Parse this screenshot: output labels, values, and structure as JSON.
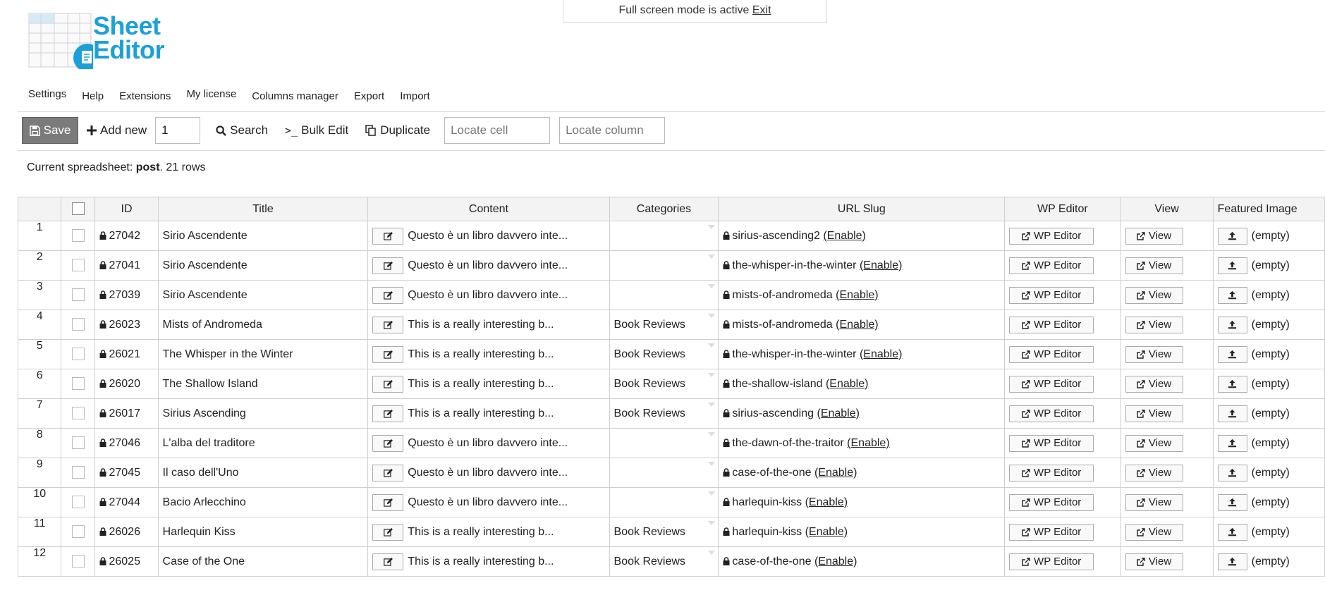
{
  "notice": {
    "text": "Full screen mode is active",
    "exit_label": "Exit"
  },
  "logo": {
    "line1": "Sheet",
    "line2": "Editor",
    "brand_color": "#1da0d8"
  },
  "menu": [
    "Settings",
    "Help",
    "Extensions",
    "My license",
    "Columns manager",
    "Export",
    "Import"
  ],
  "toolbar": {
    "save_label": "Save",
    "add_new_label": "Add new",
    "add_new_count": "1",
    "search_label": "Search",
    "bulk_edit_label": "Bulk Edit",
    "duplicate_label": "Duplicate",
    "locate_cell_placeholder": "Locate cell",
    "locate_column_placeholder": "Locate column"
  },
  "status": {
    "prefix": "Current spreadsheet: ",
    "type": "post",
    "rows": ". 21 rows"
  },
  "columns": [
    "ID",
    "Title",
    "Content",
    "Categories",
    "URL Slug",
    "WP Editor",
    "View",
    "Featured Image"
  ],
  "cell_labels": {
    "wp_editor": "WP Editor",
    "view": "View",
    "enable": "(Enable)",
    "empty": "(empty)"
  },
  "rows": [
    {
      "n": "1",
      "id": "27042",
      "title": "Sirio Ascendente",
      "content": "Questo è un libro davvero inte...",
      "category": "",
      "slug": "sirius-ascending2"
    },
    {
      "n": "2",
      "id": "27041",
      "title": "Sirio Ascendente",
      "content": "Questo è un libro davvero inte...",
      "category": "",
      "slug": "the-whisper-in-the-winter"
    },
    {
      "n": "3",
      "id": "27039",
      "title": "Sirio Ascendente",
      "content": "Questo è un libro davvero inte...",
      "category": "",
      "slug": "mists-of-andromeda"
    },
    {
      "n": "4",
      "id": "26023",
      "title": "Mists of Andromeda",
      "content": "This is a really interesting b...",
      "category": "Book Reviews",
      "slug": "mists-of-andromeda"
    },
    {
      "n": "5",
      "id": "26021",
      "title": "The Whisper in the Winter",
      "content": "This is a really interesting b...",
      "category": "Book Reviews",
      "slug": "the-whisper-in-the-winter"
    },
    {
      "n": "6",
      "id": "26020",
      "title": "The Shallow Island",
      "content": "This is a really interesting b...",
      "category": "Book Reviews",
      "slug": "the-shallow-island"
    },
    {
      "n": "7",
      "id": "26017",
      "title": "Sirius Ascending",
      "content": "This is a really interesting b...",
      "category": "Book Reviews",
      "slug": "sirius-ascending"
    },
    {
      "n": "8",
      "id": "27046",
      "title": "L'alba del traditore",
      "content": "Questo è un libro davvero inte...",
      "category": "",
      "slug": "the-dawn-of-the-traitor"
    },
    {
      "n": "9",
      "id": "27045",
      "title": "Il caso dell'Uno",
      "content": "Questo è un libro davvero inte...",
      "category": "",
      "slug": "case-of-the-one"
    },
    {
      "n": "10",
      "id": "27044",
      "title": "Bacio Arlecchino",
      "content": "Questo è un libro davvero inte...",
      "category": "",
      "slug": "harlequin-kiss"
    },
    {
      "n": "11",
      "id": "26026",
      "title": "Harlequin Kiss",
      "content": "This is a really interesting b...",
      "category": "Book Reviews",
      "slug": "harlequin-kiss"
    },
    {
      "n": "12",
      "id": "26025",
      "title": "Case of the One",
      "content": "This is a really interesting b...",
      "category": "Book Reviews",
      "slug": "case-of-the-one"
    }
  ]
}
